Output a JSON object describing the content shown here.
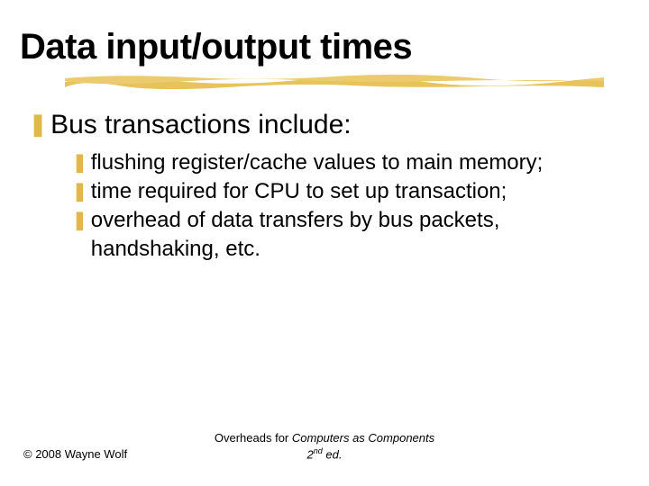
{
  "title": "Data input/output times",
  "level1": {
    "text": "Bus transactions include:"
  },
  "level2": [
    {
      "text": "flushing register/cache values to main memory;"
    },
    {
      "text": "time required for CPU to set up transaction;"
    },
    {
      "text": "overhead of data transfers by bus packets, handshaking, etc."
    }
  ],
  "footer": {
    "copyright": "© 2008 Wayne Wolf",
    "overheads_prefix": "Overheads for ",
    "overheads_italic": "Computers as Components",
    "overheads_edition_prefix": " 2",
    "overheads_edition_suffix": "nd",
    "overheads_edition_end": " ed."
  }
}
